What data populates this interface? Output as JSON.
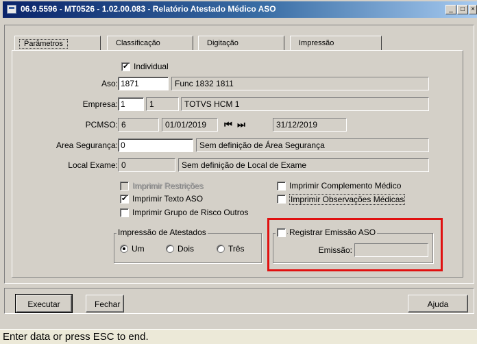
{
  "window": {
    "title": "06.9.5596 - MT0526 - 1.02.00.083 - Relatório Atestado Médico ASO",
    "min": "_",
    "max": "□",
    "close": "×"
  },
  "tabs": [
    "Parâmetros",
    "Classificação",
    "Digitação",
    "Impressão"
  ],
  "individual_label": "Individual",
  "aso": {
    "label": "Aso:",
    "value": "1871",
    "desc": "Func 1832 1811"
  },
  "empresa": {
    "label": "Empresa:",
    "value1": "1",
    "value2": "1",
    "desc": "TOTVS HCM 1"
  },
  "pcmso": {
    "label": "PCMSO:",
    "value": "6",
    "date_start": "01/01/2019",
    "date_end": "31/12/2019",
    "prev_icon": "⏮",
    "next_icon": "⏭"
  },
  "area": {
    "label": "Area Segurança:",
    "value": "0",
    "desc": "Sem definição de Área Segurança"
  },
  "local": {
    "label": "Local Exame:",
    "value": "0",
    "desc": "Sem definição de Local de Exame"
  },
  "options": {
    "imprimir_restricoes": "Imprimir Restrições",
    "imprimir_texto_aso": "Imprimir Texto ASO",
    "imprimir_grupo_risco": "Imprimir Grupo de Risco Outros",
    "imprimir_complemento": "Imprimir Complemento Médico",
    "imprimir_observacoes": "Imprimir Observações Médicas"
  },
  "impressao": {
    "title": "Impressão de Atestados",
    "options": [
      "Um",
      "Dois",
      "Três"
    ],
    "selected": "Um"
  },
  "registrar": {
    "label": "Registrar Emissão ASO",
    "emissao_label": "Emissão:",
    "emissao_value": ""
  },
  "buttons": {
    "executar": "Executar",
    "fechar": "Fechar",
    "ajuda": "Ajuda"
  },
  "status": "Enter data or press ESC to end."
}
